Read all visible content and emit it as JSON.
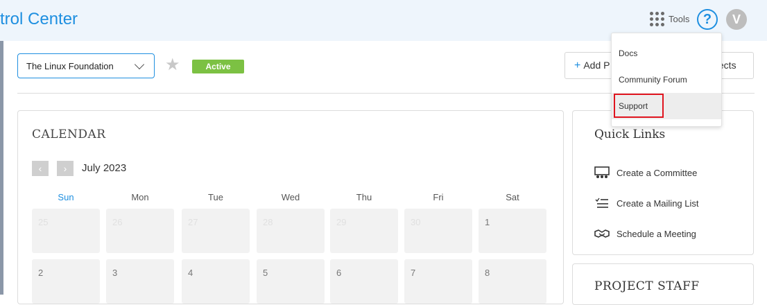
{
  "header": {
    "title": "trol Center",
    "tools_label": "Tools",
    "help_symbol": "?",
    "avatar_initial": "V",
    "accent_color": "#1e8fe0"
  },
  "tools_menu": {
    "items": [
      {
        "label": "Docs"
      },
      {
        "label": "Community Forum"
      },
      {
        "label": "Support",
        "highlighted": true
      }
    ]
  },
  "toolbar": {
    "org_select_value": "The Linux Foundation",
    "status_badge": "Active",
    "status_color": "#7cc143",
    "add_button_label": "Add P",
    "projects_button_label": "ojects"
  },
  "calendar": {
    "title": "CALENDAR",
    "month": "July 2023",
    "prev_symbol": "‹",
    "next_symbol": "›",
    "weekdays": [
      "Sun",
      "Mon",
      "Tue",
      "Wed",
      "Thu",
      "Fri",
      "Sat"
    ],
    "weeks": [
      [
        {
          "day": "25",
          "muted": true
        },
        {
          "day": "26",
          "muted": true
        },
        {
          "day": "27",
          "muted": true
        },
        {
          "day": "28",
          "muted": true
        },
        {
          "day": "29",
          "muted": true
        },
        {
          "day": "30",
          "muted": true
        },
        {
          "day": "1",
          "muted": false
        }
      ],
      [
        {
          "day": "2",
          "muted": false
        },
        {
          "day": "3",
          "muted": false
        },
        {
          "day": "4",
          "muted": false
        },
        {
          "day": "5",
          "muted": false
        },
        {
          "day": "6",
          "muted": false
        },
        {
          "day": "7",
          "muted": false
        },
        {
          "day": "8",
          "muted": false
        }
      ]
    ]
  },
  "quick_links": {
    "title": "Quick Links",
    "items": [
      {
        "label": "Create a Committee",
        "icon": "committee-icon"
      },
      {
        "label": "Create a Mailing List",
        "icon": "mailing-list-icon"
      },
      {
        "label": "Schedule a Meeting",
        "icon": "handshake-icon"
      }
    ]
  },
  "project_staff": {
    "title": "PROJECT STAFF"
  }
}
